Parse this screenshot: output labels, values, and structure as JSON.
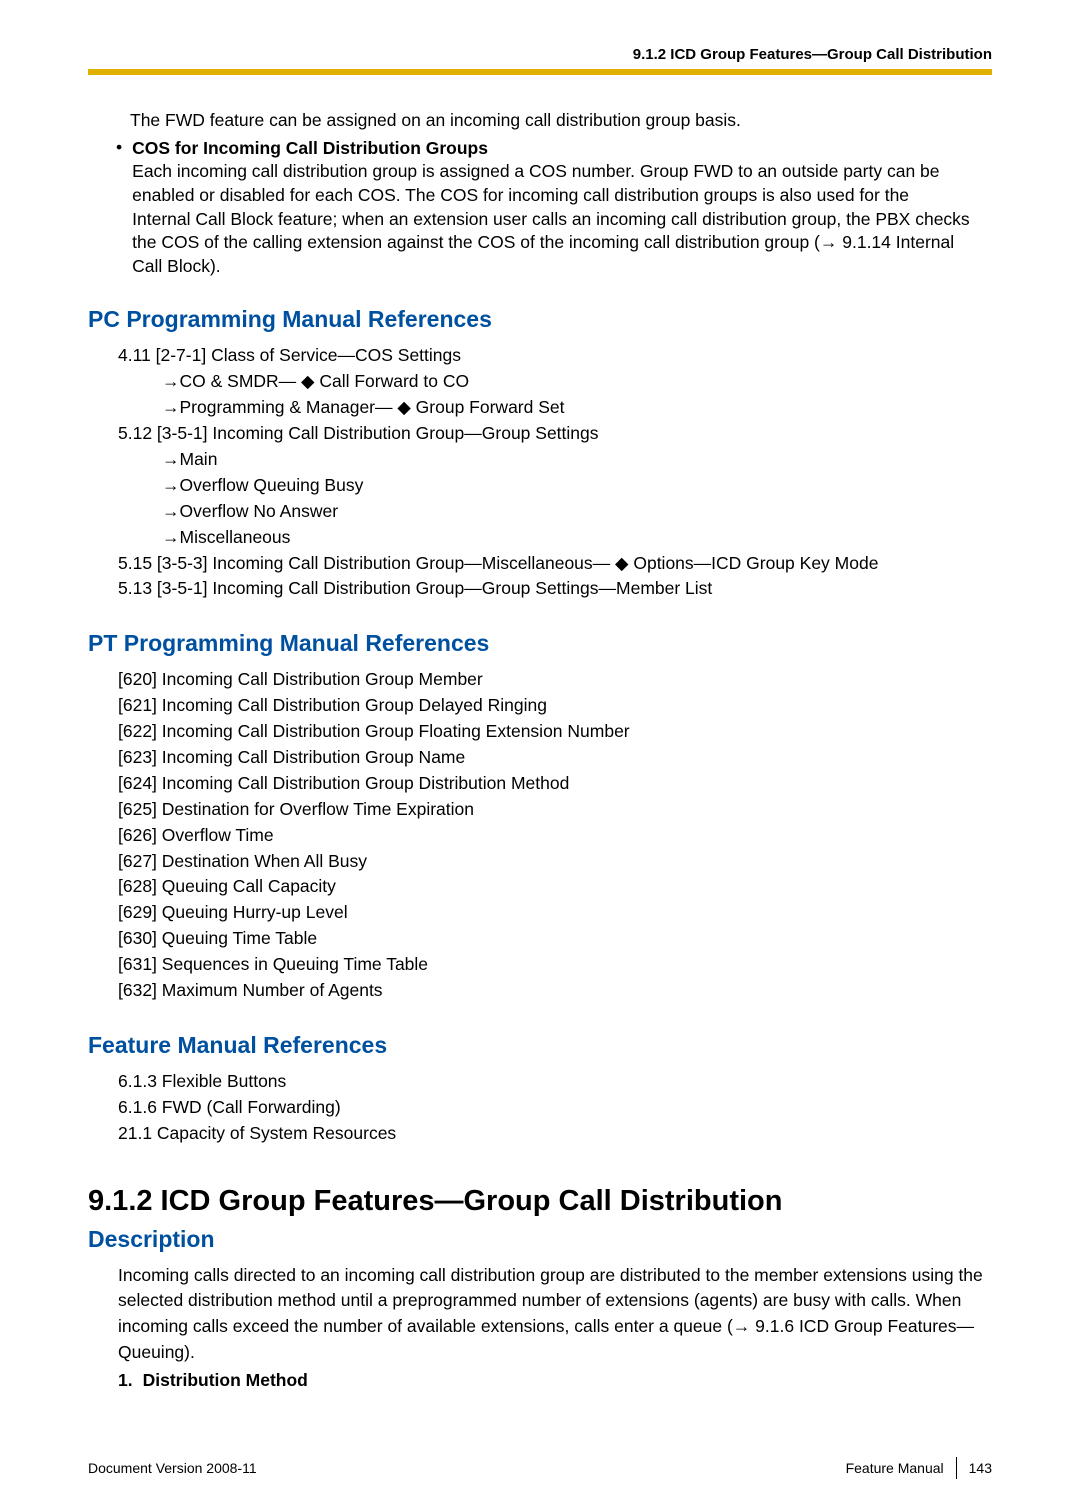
{
  "header": {
    "right": "9.1.2 ICD Group Features—Group Call Distribution"
  },
  "intro": {
    "line1": "The FWD feature can be assigned on an incoming call distribution group basis.",
    "bullet_title": "COS for Incoming Call Distribution Groups",
    "bullet_body": "Each incoming call distribution group is assigned a COS number. Group FWD to an outside party can be enabled or disabled for each COS. The COS for incoming call distribution groups is also used for the Internal Call Block feature; when an extension user calls an incoming call distribution group, the PBX checks the COS of the calling extension against the COS of the incoming call distribution group (→ 9.1.14  Internal Call Block)."
  },
  "pc_section": {
    "title": "PC Programming Manual References",
    "lines": [
      "4.11  [2-7-1] Class of Service—COS Settings",
      "→CO & SMDR— ◆ Call Forward to CO",
      "→Programming & Manager— ◆ Group Forward Set",
      "5.12  [3-5-1] Incoming Call Distribution Group—Group Settings",
      "→Main",
      "→Overflow Queuing Busy",
      "→Overflow No Answer",
      "→Miscellaneous",
      "5.15  [3-5-3] Incoming Call Distribution Group—Miscellaneous— ◆ Options—ICD Group Key Mode",
      "5.13  [3-5-1] Incoming Call Distribution Group—Group Settings—Member List"
    ]
  },
  "pt_section": {
    "title": "PT Programming Manual References",
    "lines": [
      "[620] Incoming Call Distribution Group Member",
      "[621] Incoming Call Distribution Group Delayed Ringing",
      "[622] Incoming Call Distribution Group Floating Extension Number",
      "[623] Incoming Call Distribution Group Name",
      "[624] Incoming Call Distribution Group Distribution Method",
      "[625] Destination for Overflow Time Expiration",
      "[626] Overflow Time",
      "[627] Destination When All Busy",
      "[628] Queuing Call Capacity",
      "[629] Queuing Hurry-up Level",
      "[630] Queuing Time Table",
      "[631] Sequences in Queuing Time Table",
      "[632] Maximum Number of Agents"
    ]
  },
  "feat_section": {
    "title": "Feature Manual References",
    "lines": [
      "6.1.3  Flexible Buttons",
      "6.1.6  FWD (Call Forwarding)",
      "21.1  Capacity of System Resources"
    ]
  },
  "chapter": {
    "title": "9.1.2  ICD Group Features—Group Call Distribution",
    "subhead": "Description",
    "body": "Incoming calls directed to an incoming call distribution group are distributed to the member extensions using the selected distribution method until a preprogrammed number of extensions (agents) are busy with calls. When incoming calls exceed the number of available extensions, calls enter a queue (→ 9.1.6  ICD Group Features—Queuing).",
    "num1_label": "1.",
    "num1_text": "Distribution Method"
  },
  "footer": {
    "left_label": "Document Version  2008-11",
    "right_label": "Feature Manual",
    "page": "143"
  }
}
